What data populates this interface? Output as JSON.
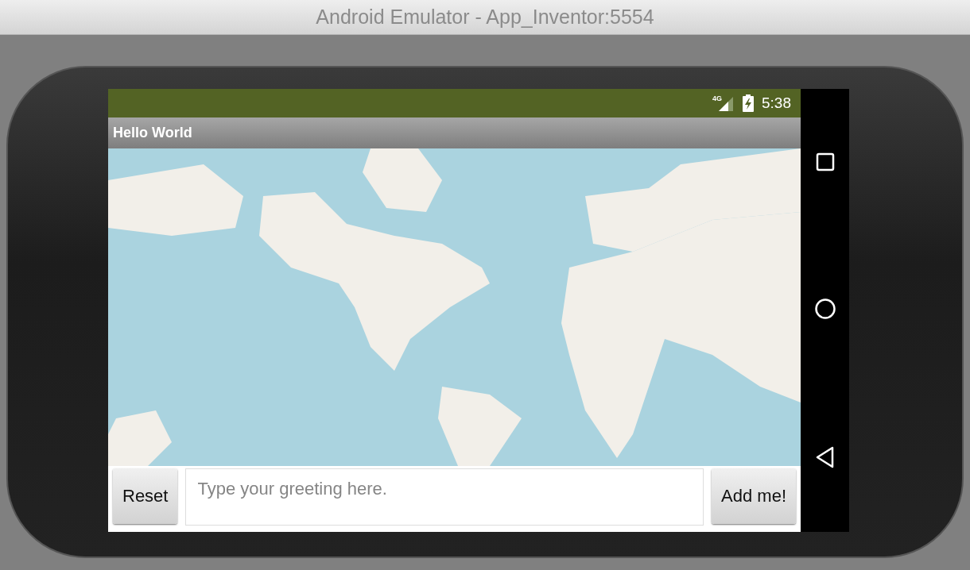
{
  "window": {
    "title": "Android Emulator - App_Inventor:5554"
  },
  "status_bar": {
    "network": "4G",
    "time": "5:38"
  },
  "action_bar": {
    "title": "Hello World"
  },
  "controls": {
    "reset_button": "Reset",
    "greeting_field": {
      "placeholder": "Type your greeting here."
    },
    "add_button": "Add me!"
  }
}
